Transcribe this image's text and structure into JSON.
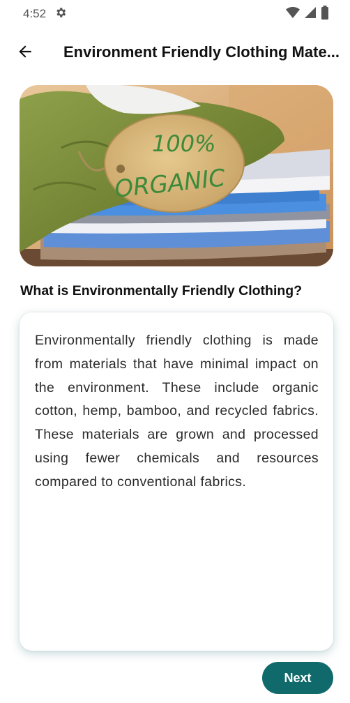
{
  "status_bar": {
    "time": "4:52",
    "icons": [
      "gear-icon",
      "wifi-icon",
      "signal-icon",
      "battery-icon"
    ]
  },
  "app_bar": {
    "back_icon": "arrow-left-icon",
    "title": "Environment Friendly Clothing Mate..."
  },
  "hero_image": {
    "tag_line1": "100%",
    "tag_line2": "ORGANIC"
  },
  "content": {
    "heading": "What is Environmentally Friendly Clothing?",
    "body": "Environmentally friendly clothing is made from materials that have minimal impact on the environment. These include organic cotton, hemp, bamboo, and recycled fabrics. These materials are grown and processed using fewer chemicals and resources compared to conventional fabrics."
  },
  "actions": {
    "next_label": "Next"
  },
  "colors": {
    "accent": "#10696b",
    "background": "#ffffff"
  }
}
